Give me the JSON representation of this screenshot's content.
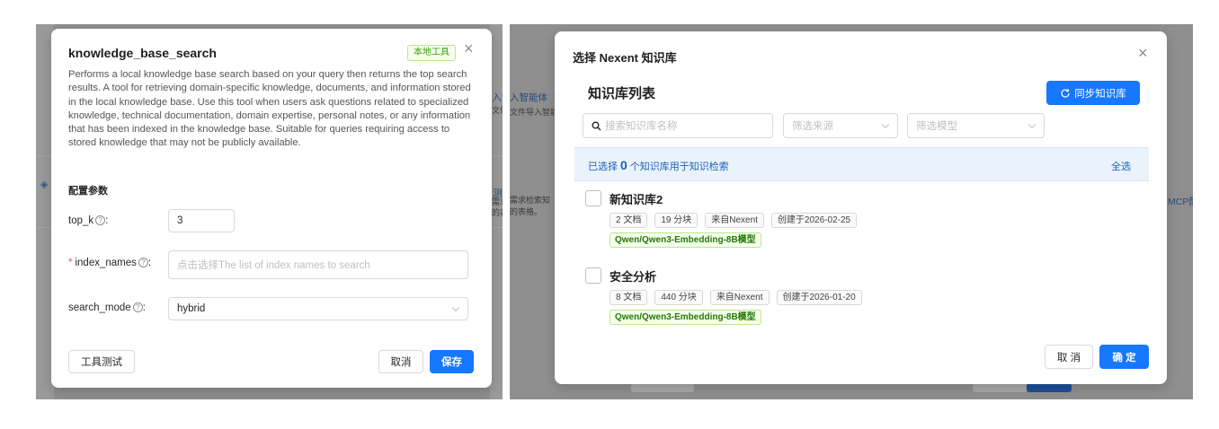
{
  "left": {
    "background": {
      "text_1": "入智能体",
      "text_2": "文件导入智能",
      "text_3": "测",
      "text_4": "需求检索知",
      "text_5": "的表格。"
    },
    "dialog": {
      "title": "knowledge_base_search",
      "tag": "本地工具",
      "close_glyph": "×",
      "description": "Performs a local knowledge base search based on your query then returns the top search results. A tool for retrieving domain-specific knowledge, documents, and information stored in the local knowledge base. Use this tool when users ask questions related to specialized knowledge, technical documentation, domain expertise, personal notes, or any information that has been indexed in the knowledge base. Suitable for queries requiring access to stored knowledge that may not be publicly available.",
      "section_title": "配置参数",
      "fields": {
        "top_k": {
          "label": "top_k",
          "colon": ":",
          "value": "3"
        },
        "index_names": {
          "required_mark": "*",
          "label": "index_names",
          "colon": ":",
          "placeholder": "点击选择The list of index names to search"
        },
        "search_mode": {
          "label": "search_mode",
          "colon": ":",
          "value": "hybrid"
        }
      },
      "question_glyph": "?",
      "buttons": {
        "test": "工具测试",
        "cancel": "取消",
        "save": "保存"
      }
    }
  },
  "right": {
    "background": {
      "text_1": "MCP配"
    },
    "dialog": {
      "title": "选择 Nexent 知识库",
      "close_glyph": "×",
      "heading": "知识库列表",
      "sync_button": "同步知识库",
      "search_placeholder": "搜索知识库名称",
      "filter_source_placeholder": "筛选来源",
      "filter_model_placeholder": "筛选模型",
      "selection": {
        "prefix": "已选择",
        "count": "0",
        "suffix": "个知识库用于知识检索",
        "select_all": "全选"
      },
      "items": [
        {
          "name": "新知识库2",
          "tags": [
            "2 文档",
            "19 分块",
            "来自Nexent",
            "创建于2026-02-25"
          ],
          "model": "Qwen/Qwen3-Embedding-8B模型"
        },
        {
          "name": "安全分析",
          "tags": [
            "8 文档",
            "440 分块",
            "来自Nexent",
            "创建于2026-01-20"
          ],
          "model": "Qwen/Qwen3-Embedding-8B模型"
        }
      ],
      "buttons": {
        "cancel": "取 消",
        "confirm": "确 定"
      }
    }
  },
  "colors": {
    "primary": "#1677ff",
    "tag_green_text": "#389e0d",
    "tag_green_bg": "#f6ffed",
    "overlay": "#8f8f8f",
    "selection_bar": "#eaf3fc"
  }
}
